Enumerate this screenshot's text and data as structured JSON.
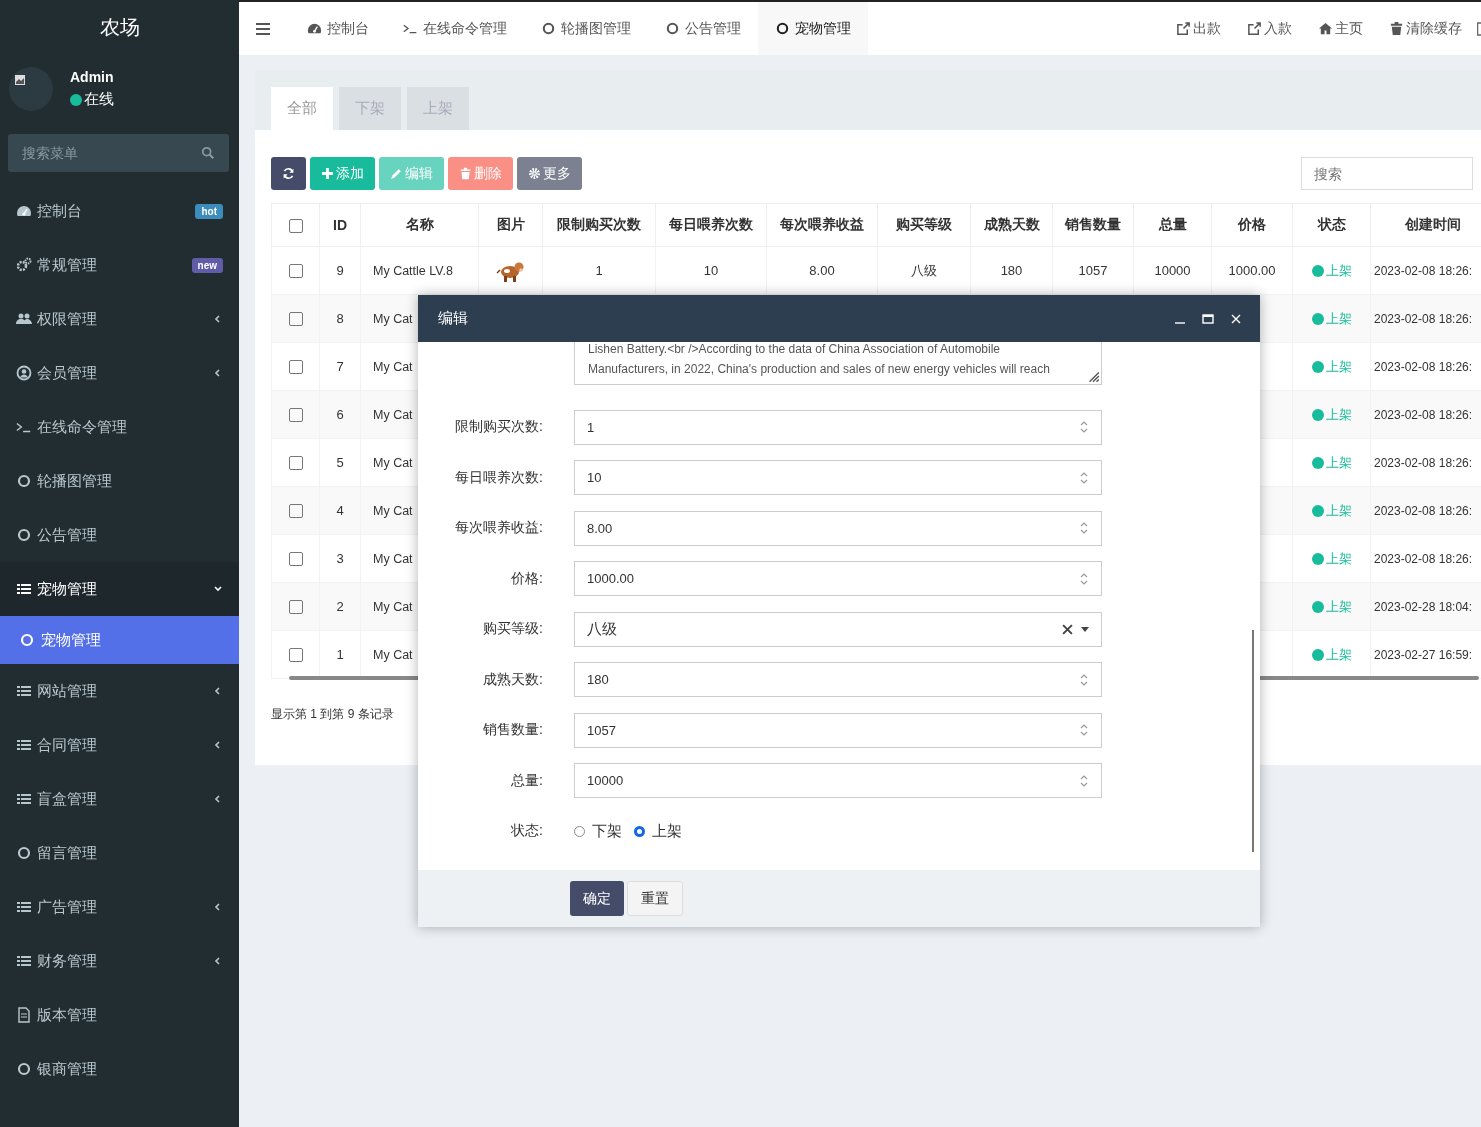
{
  "sidebar": {
    "logo": "农场",
    "user": {
      "name": "Admin",
      "status": "在线"
    },
    "search": {
      "placeholder": "搜索菜单"
    },
    "items": [
      {
        "label": "控制台",
        "kind": "link",
        "selected": false,
        "badge": {
          "text": "hot",
          "color": "#3c8dbc"
        }
      },
      {
        "label": "常规管理",
        "kind": "link",
        "selected": false,
        "badge": {
          "text": "new",
          "color": "#605ca8"
        }
      },
      {
        "label": "权限管理",
        "kind": "group",
        "selected": false,
        "expanded": false
      },
      {
        "label": "会员管理",
        "kind": "group",
        "selected": false,
        "expanded": false
      },
      {
        "label": "在线命令管理",
        "kind": "link",
        "selected": false
      },
      {
        "label": "轮播图管理",
        "kind": "link",
        "selected": false
      },
      {
        "label": "公告管理",
        "kind": "link",
        "selected": false
      },
      {
        "label": "宠物管理",
        "kind": "group",
        "selected": false,
        "expanded": true,
        "children": [
          {
            "label": "宠物管理",
            "kind": "link",
            "selected": true
          }
        ]
      },
      {
        "label": "网站管理",
        "kind": "group",
        "selected": false,
        "expanded": false
      },
      {
        "label": "合同管理",
        "kind": "group",
        "selected": false,
        "expanded": false
      },
      {
        "label": "盲盒管理",
        "kind": "group",
        "selected": false,
        "expanded": false
      },
      {
        "label": "留言管理",
        "kind": "link",
        "selected": false
      },
      {
        "label": "广告管理",
        "kind": "group",
        "selected": false,
        "expanded": false
      },
      {
        "label": "财务管理",
        "kind": "group",
        "selected": false,
        "expanded": false
      },
      {
        "label": "版本管理",
        "kind": "link",
        "selected": false
      },
      {
        "label": "银商管理",
        "kind": "link",
        "selected": false
      }
    ]
  },
  "topnav": {
    "tabs": [
      {
        "label": "控制台",
        "selected": false
      },
      {
        "label": "在线命令管理",
        "selected": false
      },
      {
        "label": "轮播图管理",
        "selected": false
      },
      {
        "label": "公告管理",
        "selected": false
      },
      {
        "label": "宠物管理",
        "selected": true
      }
    ],
    "links": [
      {
        "label": "出款"
      },
      {
        "label": "入款"
      },
      {
        "label": "主页"
      },
      {
        "label": "清除缓存"
      }
    ]
  },
  "panel": {
    "tabs": [
      {
        "label": "全部",
        "selected": true
      },
      {
        "label": "下架",
        "selected": false
      },
      {
        "label": "上架",
        "selected": false
      }
    ],
    "toolbar": [
      {
        "kind": "refresh",
        "disabled": false
      },
      {
        "kind": "add",
        "label": "添加",
        "disabled": false
      },
      {
        "kind": "edit",
        "label": "编辑",
        "disabled": true
      },
      {
        "kind": "delete",
        "label": "删除",
        "disabled": true
      },
      {
        "kind": "more",
        "label": "更多",
        "disabled": false
      }
    ],
    "search": {
      "placeholder": "搜索"
    },
    "table": {
      "columns": [
        "ID",
        "名称",
        "图片",
        "限制购买次数",
        "每日喂养次数",
        "每次喂养收益",
        "购买等级",
        "成熟天数",
        "销售数量",
        "总量",
        "价格",
        "状态",
        "创建时间"
      ],
      "header_checked": false,
      "rows": [
        {
          "checked": false,
          "cells": [
            "9",
            "My Cattle LV.8",
            null,
            "1",
            "10",
            "8.00",
            "八级",
            "180",
            "1057",
            "10000",
            "1000.00"
          ],
          "status": "上架",
          "created": "2023-02-08 18:26:"
        },
        {
          "checked": false,
          "cells": [
            "8",
            "My Cat"
          ],
          "status": "上架",
          "created": "2023-02-08 18:26:"
        },
        {
          "checked": false,
          "cells": [
            "7",
            "My Cat"
          ],
          "status": "上架",
          "created": "2023-02-08 18:26:"
        },
        {
          "checked": false,
          "cells": [
            "6",
            "My Cat"
          ],
          "status": "上架",
          "created": "2023-02-08 18:26:"
        },
        {
          "checked": false,
          "cells": [
            "5",
            "My Cat"
          ],
          "status": "上架",
          "created": "2023-02-08 18:26:"
        },
        {
          "checked": false,
          "cells": [
            "4",
            "My Cat"
          ],
          "status": "上架",
          "created": "2023-02-08 18:26:"
        },
        {
          "checked": false,
          "cells": [
            "3",
            "My Cat"
          ],
          "status": "上架",
          "created": "2023-02-08 18:26:"
        },
        {
          "checked": false,
          "cells": [
            "2",
            "My Cat"
          ],
          "status": "上架",
          "created": "2023-02-28 18:04:"
        },
        {
          "checked": false,
          "cells": [
            "1",
            "My Cat"
          ],
          "status": "上架",
          "created": "2023-02-27 16:59:"
        }
      ]
    },
    "footer_text": "显示第 1 到第 9 条记录"
  },
  "modal": {
    "title": "编辑",
    "textarea": {
      "lines": [
        "Lishen Battery.<br />According to the data of China Association of Automobile",
        "Manufacturers, in 2022, China's production and sales of new energy vehicles will reach"
      ]
    },
    "fields": [
      {
        "label": "限制购买次数:",
        "kind": "number",
        "value": "1"
      },
      {
        "label": "每日喂养次数:",
        "kind": "number",
        "value": "10"
      },
      {
        "label": "每次喂养收益:",
        "kind": "number",
        "value": "8.00"
      },
      {
        "label": "价格:",
        "kind": "number",
        "value": "1000.00"
      },
      {
        "label": "购买等级:",
        "kind": "select",
        "value": "八级"
      },
      {
        "label": "成熟天数:",
        "kind": "number",
        "value": "180"
      },
      {
        "label": "销售数量:",
        "kind": "number",
        "value": "1057"
      },
      {
        "label": "总量:",
        "kind": "number",
        "value": "10000"
      },
      {
        "label": "状态:",
        "kind": "radio",
        "options": [
          {
            "label": "下架",
            "selected": false
          },
          {
            "label": "上架",
            "selected": true
          }
        ]
      }
    ],
    "buttons": [
      {
        "label": "确定",
        "kind": "primary"
      },
      {
        "label": "重置",
        "kind": "default"
      }
    ]
  }
}
